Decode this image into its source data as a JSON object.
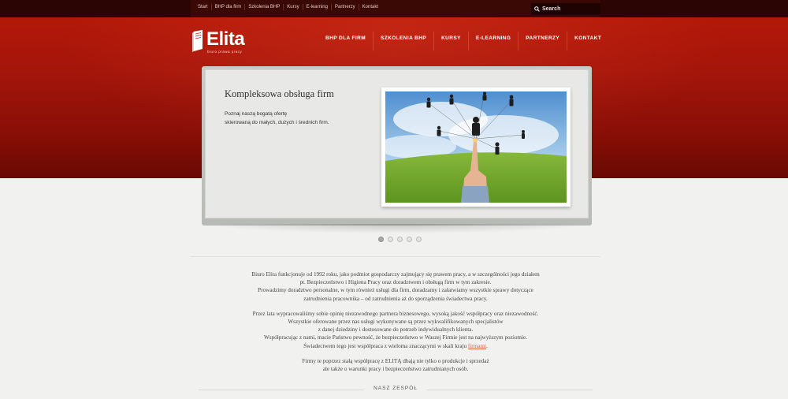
{
  "topbar": {
    "links": [
      "Start",
      "BHP dla firm",
      "Szkolenia BHP",
      "Kursy",
      "E-learning",
      "Partnerzy",
      "Kontakt"
    ],
    "search_label": "Search"
  },
  "logo": {
    "name": "Elita",
    "tagline": "biuro prawa pracy"
  },
  "nav": [
    "BHP DLA FIRM",
    "SZKOLENIA BHP",
    "KURSY",
    "E-LEARNING",
    "PARTNERZY",
    "KONTAKT"
  ],
  "slide": {
    "title": "Kompleksowa obsługa firm",
    "text_line1": "Poznaj naszą bogatą ofertę",
    "text_line2": "skierowaną do małych, dużych i średnich firm.",
    "active_index": 0,
    "count": 5
  },
  "content": {
    "p1": [
      "Biuro Elita funkcjonuje od 1992 roku, jako podmiot gospodarczy zajmujący się prawem pracy, a w szczególności jego działem",
      "pt. Bezpieczeństwo i Higiena Pracy oraz doradztwem i obsługą firm w tym zakresie.",
      "Prowadzimy doradztwo personalne, w tym również usługi dla firm, doradzamy i załatwiamy wszystkie sprawy dotyczące",
      "zatrudnienia pracownika – od zatrudnienia aż do sporządzenia świadectwa pracy."
    ],
    "p2": [
      "Przez lata wypracowaliśmy sobie opinię niezawodnego partnera biznesowego, wysoką jakość współpracy oraz niezawodność.",
      "Wszystkie oferowane przez nas usługi wykonywane są przez wykwalifikowanych specjalistów",
      "z danej dziedziny i dostosowane do potrzeb indywidualnych klienta.",
      "Współpracując z nami, macie Państwo pewność, że bezpieczeństwo w Waszej Firmie jest na najwyższym poziomie."
    ],
    "p2_last_prefix": "Świadectwem tego jest współpraca z wieloma znaczącymi w skali kraju ",
    "p2_link": "firmami",
    "p2_last_suffix": ".",
    "p3": [
      "Firmy te poprzez stałą współpracę z ELITĄ dbają nie tylko o produkcje i sprzedaż",
      "ale także o warunki pracy i bezpieczeństwo zatrudnianych osób."
    ]
  },
  "team_heading": "NASZ ZESPÓŁ",
  "colors": {
    "header_red": "#a3150a",
    "link": "#d9623f",
    "topbar": "#2a0503"
  }
}
